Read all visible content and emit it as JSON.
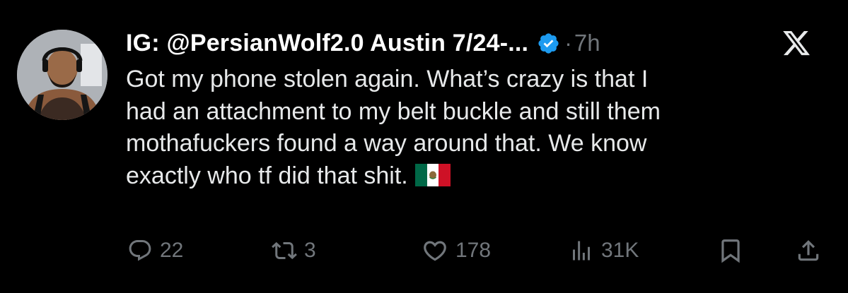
{
  "post": {
    "display_name": "IG: @PersianWolf2.0 Austin 7/24-...",
    "separator": "·",
    "time": "7h",
    "text_lines": [
      "Got my phone stolen again. What’s crazy is that I",
      "had an attachment to my belt buckle and still them",
      "mothafuckers found a way around that. We know",
      "exactly who tf did that shit."
    ],
    "flag_icon": "mexico-flag"
  },
  "actions": {
    "reply": {
      "icon": "reply-icon",
      "count": "22"
    },
    "repost": {
      "icon": "repost-icon",
      "count": "3"
    },
    "like": {
      "icon": "heart-icon",
      "count": "178"
    },
    "views": {
      "icon": "views-icon",
      "count": "31K"
    },
    "bookmark": {
      "icon": "bookmark-icon"
    },
    "share": {
      "icon": "share-icon"
    }
  },
  "colors": {
    "background": "#000000",
    "text": "#e7e9ea",
    "muted": "#71767b",
    "verified": "#1d9bf0"
  }
}
